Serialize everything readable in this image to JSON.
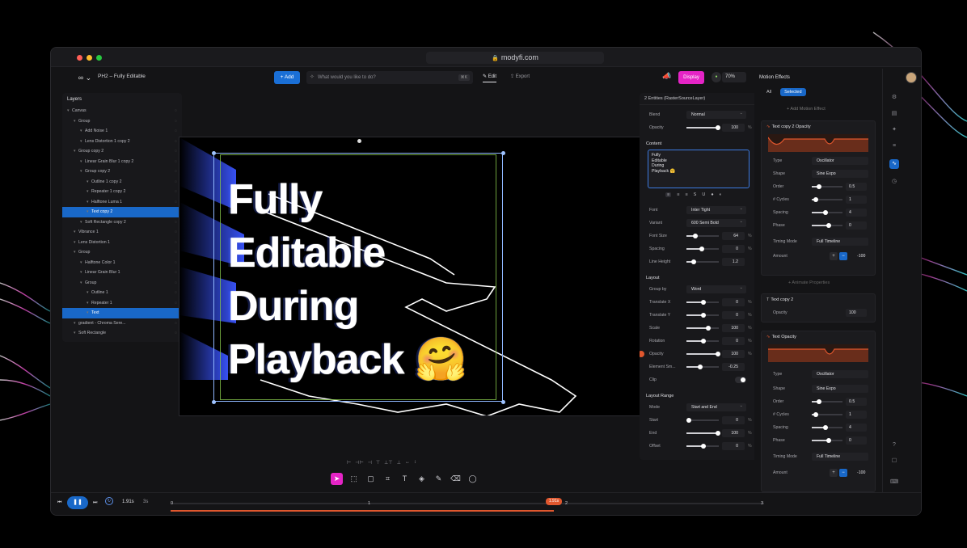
{
  "window": {
    "url": "modyfi.com",
    "project_title": "PH2 – Fully Editable",
    "dot_colors": [
      "#ff5f57",
      "#febc2e",
      "#28c840"
    ]
  },
  "toolbar": {
    "add_label": "+ Add",
    "prompt_placeholder": "What would you like to do?",
    "prompt_shortcut": "⌘K",
    "tab_edit": "Edit",
    "tab_export": "Export",
    "display_label": "Display",
    "zoom": "70%"
  },
  "layers": {
    "title": "Layers",
    "items": [
      {
        "label": "Canvas",
        "depth": 0,
        "selected": false
      },
      {
        "label": "Group",
        "depth": 1,
        "selected": false
      },
      {
        "label": "Add Noise 1",
        "depth": 2,
        "selected": false
      },
      {
        "label": "Lens Distortion 1 copy 2",
        "depth": 2,
        "selected": false
      },
      {
        "label": "Group copy 2",
        "depth": 1,
        "selected": false
      },
      {
        "label": "Linear Grain Blur 1 copy 2",
        "depth": 2,
        "selected": false
      },
      {
        "label": "Group copy 2",
        "depth": 2,
        "selected": false
      },
      {
        "label": "Outline 1 copy 2",
        "depth": 3,
        "selected": false
      },
      {
        "label": "Repeater 1 copy 2",
        "depth": 3,
        "selected": false
      },
      {
        "label": "Halftone Luma 1",
        "depth": 3,
        "selected": false
      },
      {
        "label": "Text copy 2",
        "depth": 3,
        "selected": true
      },
      {
        "label": "Soft Rectangle copy 2",
        "depth": 2,
        "selected": false
      },
      {
        "label": "Vibrance 1",
        "depth": 1,
        "selected": false
      },
      {
        "label": "Lens Distortion 1",
        "depth": 1,
        "selected": false
      },
      {
        "label": "Group",
        "depth": 1,
        "selected": false
      },
      {
        "label": "Halftone Color 1",
        "depth": 2,
        "selected": false
      },
      {
        "label": "Linear Grain Blur 1",
        "depth": 2,
        "selected": false
      },
      {
        "label": "Group",
        "depth": 2,
        "selected": false
      },
      {
        "label": "Outline 1",
        "depth": 3,
        "selected": false
      },
      {
        "label": "Repeater 1",
        "depth": 3,
        "selected": false
      },
      {
        "label": "Text",
        "depth": 3,
        "selected": true
      },
      {
        "label": "gradient - Chroma Sere...",
        "depth": 1,
        "selected": false
      },
      {
        "label": "Soft Rectangle",
        "depth": 1,
        "selected": false
      }
    ]
  },
  "canvas": {
    "lines": [
      "Fully",
      "Editable",
      "During",
      "Playback 🤗"
    ]
  },
  "props": {
    "header": "2 Entities (RasterSourceLayer)",
    "blend_label": "Blend",
    "blend_value": "Normal",
    "opacity_label": "Opacity",
    "opacity_value": "100",
    "content_label": "Content",
    "content_text": "Fully\nEditable\nDuring\nPlayback 🤗",
    "format_buttons": [
      "≡",
      "≡",
      "≡",
      "S",
      "U",
      "●",
      "◐"
    ],
    "font_label": "Font",
    "font_value": "Inter Tight",
    "variant_label": "Variant",
    "variant_value": "600 Semi Bold",
    "font_size_label": "Font Size",
    "font_size_value": "64",
    "spacing_label": "Spacing",
    "spacing_value": "0",
    "line_height_label": "Line Height",
    "line_height_value": "1.2",
    "layout_label": "Layout",
    "group_by_label": "Group by",
    "group_by_value": "Word",
    "tx_label": "Translate X",
    "tx_value": "0",
    "ty_label": "Translate Y",
    "ty_value": "0",
    "scale_label": "Scale",
    "scale_value": "100",
    "rotation_label": "Rotation",
    "rotation_value": "0",
    "opacity2_label": "Opacity",
    "opacity2_value": "100",
    "element_label": "Element Sm...",
    "element_value": "-0.25",
    "clip_label": "Clip",
    "layout_range_label": "Layout Range",
    "mode_label": "Mode",
    "mode_value": "Start and End",
    "start_label": "Start",
    "start_value": "0",
    "end_label": "End",
    "end_value": "100",
    "offset_label": "Offset",
    "offset_value": "0",
    "unit_pct": "%"
  },
  "motion": {
    "title": "Motion Effects",
    "tab_all": "All",
    "tab_selected": "Selected",
    "add_effect": "+ Add Motion Effect",
    "card1": {
      "title": "Text copy 2 Opacity",
      "type_label": "Type",
      "type_value": "Oscillator",
      "shape_label": "Shape",
      "shape_value": "Sine Expo",
      "order_label": "Order",
      "order_value": "0.5",
      "cycles_label": "# Cycles",
      "cycles_value": "1",
      "spacing_label": "Spacing",
      "spacing_value": "4",
      "phase_label": "Phase",
      "phase_value": "0",
      "timing_label": "Timing Mode",
      "timing_value": "Full Timeline",
      "amount_label": "Amount",
      "amount_value": "-100"
    },
    "animate_props": "+ Animate Properties",
    "card2": {
      "title": "Text copy 2",
      "opacity_label": "Opacity",
      "opacity_value": "100"
    },
    "card3": {
      "title": "Text Opacity",
      "type_label": "Type",
      "type_value": "Oscillator",
      "shape_label": "Shape",
      "shape_value": "Sine Expo",
      "order_label": "Order",
      "order_value": "0.5",
      "cycles_label": "# Cycles",
      "cycles_value": "1",
      "spacing_label": "Spacing",
      "spacing_value": "4",
      "phase_label": "Phase",
      "phase_value": "0",
      "timing_label": "Timing Mode",
      "timing_value": "Full Timeline",
      "amount_label": "Amount",
      "amount_value": "-100"
    }
  },
  "timeline": {
    "time": "1.91s",
    "duration": "3s",
    "ticks": [
      "0",
      "1",
      "2",
      "3"
    ],
    "playhead": "1.91s"
  },
  "colors": {
    "accent_blue": "#1968c8",
    "magenta": "#e524c6",
    "orange": "#e0572e"
  }
}
